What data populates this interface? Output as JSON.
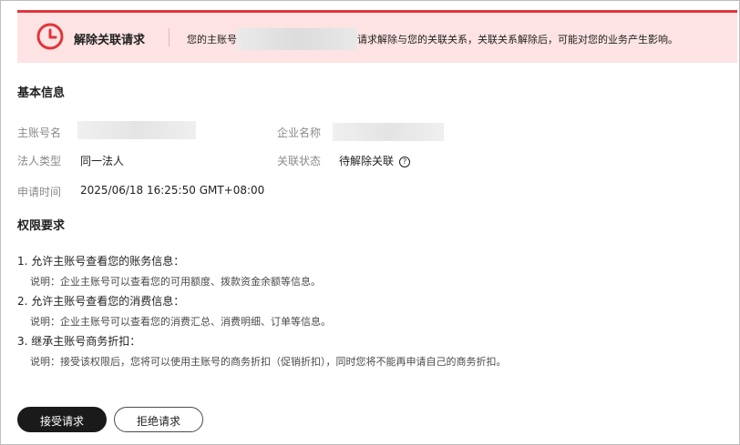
{
  "alert": {
    "icon": "clock-icon",
    "title": "解除关联请求",
    "msg_prefix": "您的主账号",
    "msg_suffix": "请求解除与您的关联关系，关联关系解除后，可能对您的业务产生影响。",
    "accent_color": "#e0353b",
    "background_color": "#fde3e3"
  },
  "basic_info": {
    "title": "基本信息",
    "main_account_label": "主账号名",
    "company_name_label": "企业名称",
    "legal_type_label": "法人类型",
    "legal_type_value": "同一法人",
    "relation_status_label": "关联状态",
    "relation_status_value": "待解除关联",
    "help_icon": "question-circle-icon",
    "apply_time_label": "申请时间",
    "apply_time_value": "2025/06/18 16:25:50 GMT+08:00"
  },
  "permissions": {
    "title": "权限要求",
    "items": [
      {
        "title": "1. 允许主账号查看您的账务信息：",
        "desc": "说明：企业主账号可以查看您的可用额度、拨款资金余额等信息。"
      },
      {
        "title": "2. 允许主账号查看您的消费信息：",
        "desc": "说明：企业主账号可以查看您的消费汇总、消费明细、订单等信息。"
      },
      {
        "title": "3. 继承主账号商务折扣：",
        "desc": "说明：接受该权限后，您将可以使用主账号的商务折扣（促销折扣），同时您将不能再申请自己的商务折扣。"
      }
    ]
  },
  "actions": {
    "accept_label": "接受请求",
    "reject_label": "拒绝请求"
  }
}
